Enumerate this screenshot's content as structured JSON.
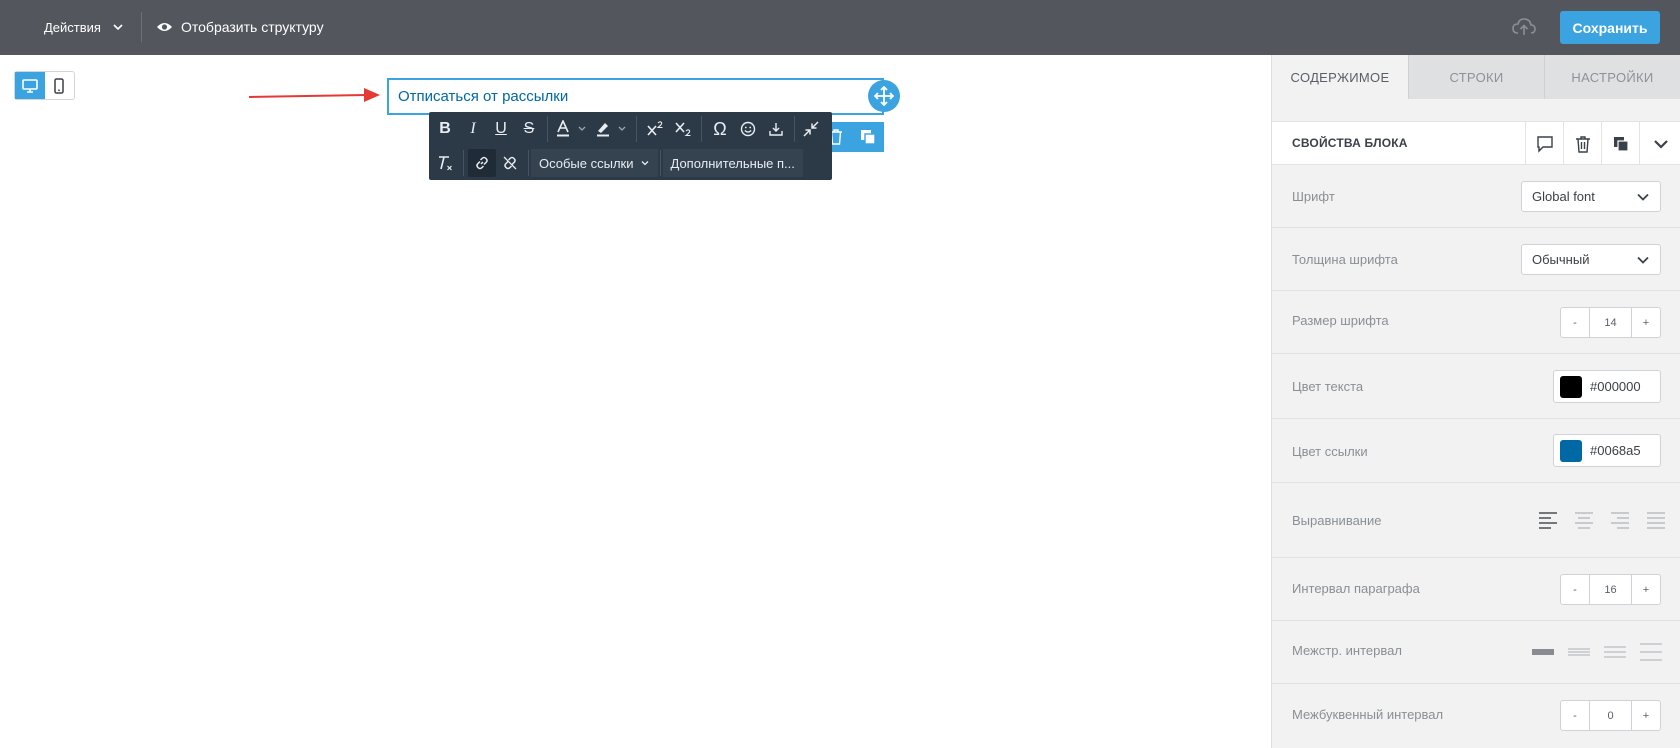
{
  "topbar": {
    "actions_label": "Действия",
    "structure_label": "Отобразить структуру",
    "save_label": "Сохранить"
  },
  "canvas": {
    "text_content": "Отписаться от рассылки",
    "text_color": "#0068a5"
  },
  "editor_toolbar": {
    "special_links_label": "Особые ссылки",
    "more_label": "Дополнительные п...",
    "bold": "B",
    "italic": "I",
    "underline": "U",
    "strike": "S",
    "omega": "Ω"
  },
  "panel": {
    "tabs": [
      {
        "label": "СОДЕРЖИМОЕ"
      },
      {
        "label": "СТРОКИ"
      },
      {
        "label": "НАСТРОЙКИ"
      }
    ],
    "block_title": "СВОЙСТВА БЛОКА",
    "font": {
      "label": "Шрифт",
      "value": "Global font"
    },
    "weight": {
      "label": "Толщина шрифта",
      "value": "Обычный"
    },
    "size": {
      "label": "Размер шрифта",
      "value": "14"
    },
    "text_color": {
      "label": "Цвет текста",
      "value": "#000000"
    },
    "link_color": {
      "label": "Цвет ссылки",
      "value": "#0068a5"
    },
    "align": {
      "label": "Выравнивание"
    },
    "paragraph": {
      "label": "Интервал параграфа",
      "value": "16"
    },
    "line_height": {
      "label": "Межстр. интервал"
    },
    "letter_spacing": {
      "label": "Межбуквенный интервал",
      "value": "0"
    },
    "minus": "-",
    "plus": "+"
  },
  "colors": {
    "accent": "#3aa3e0",
    "topbar": "#53575d",
    "arrow": "#e53935"
  }
}
